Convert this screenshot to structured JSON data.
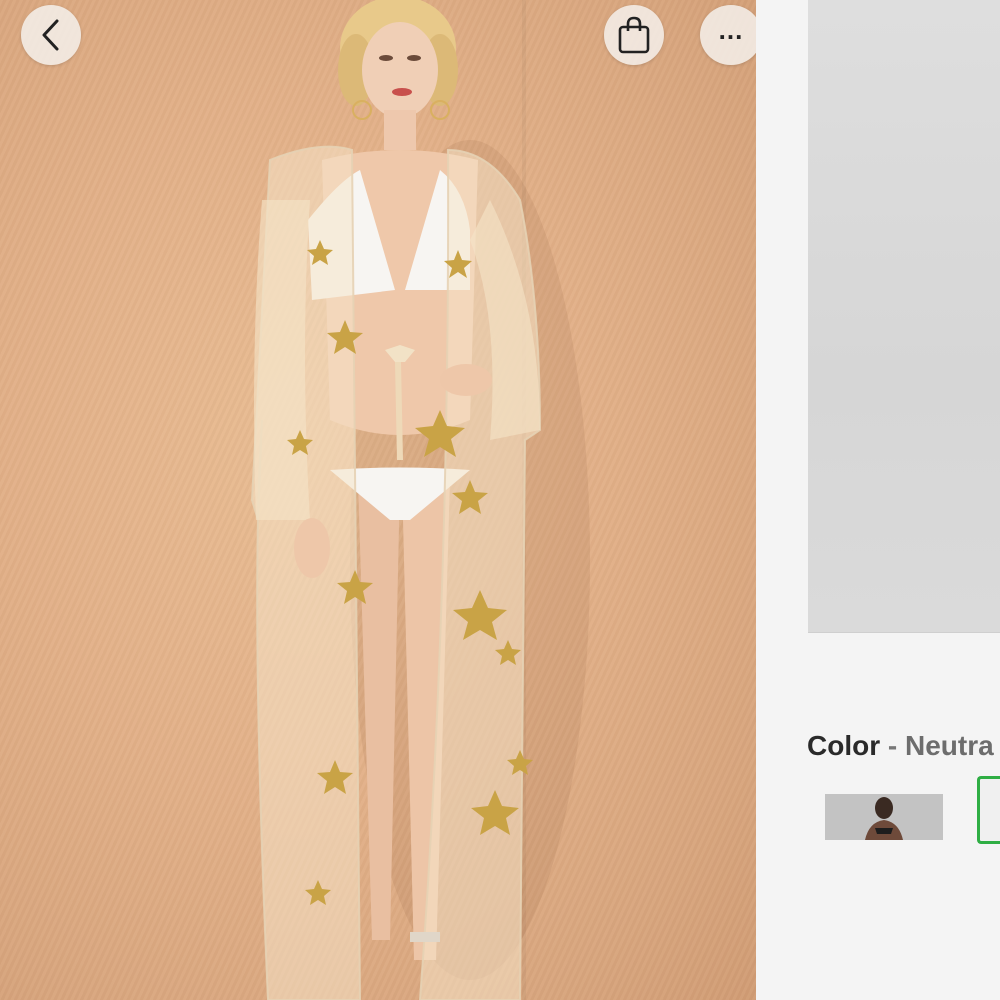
{
  "topbar": {
    "back_icon": "chevron-left-icon",
    "bag_icon": "shopping-bag-icon",
    "more_icon": "more-dots-icon",
    "more_label": "..."
  },
  "product_image": {
    "description_icon": "model-photo"
  },
  "options": {
    "color_label": "Color",
    "separator": "-",
    "color_value": "Neutra"
  },
  "colors": {
    "accent_selected": "#2fae44",
    "background": "#e2b088"
  }
}
